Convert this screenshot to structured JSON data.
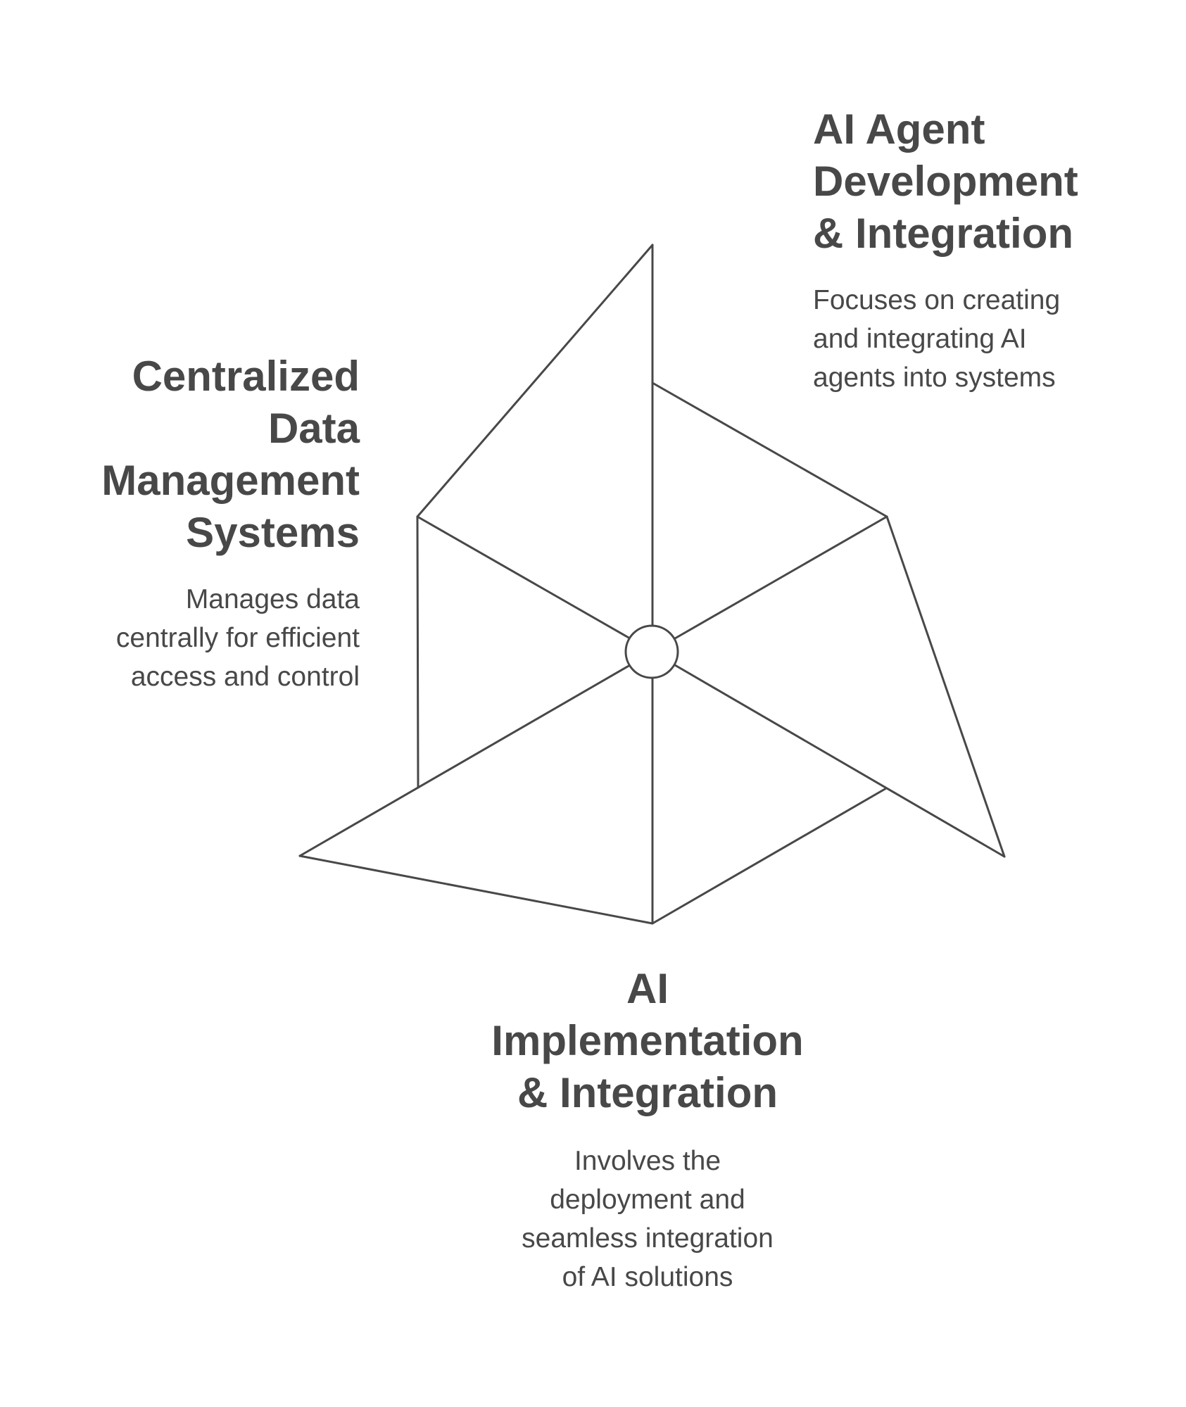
{
  "diagram": {
    "type": "three-segment hexagonal pinwheel",
    "stroke_color": "#484848",
    "text_color": "#484848",
    "background": "#ffffff",
    "segments": [
      {
        "id": "agent",
        "title_lines": [
          "AI Agent",
          "Development",
          "& Integration"
        ],
        "description_lines": [
          "Focuses on creating",
          "and integrating AI",
          "agents into systems"
        ],
        "position": "top-right"
      },
      {
        "id": "data",
        "title_lines": [
          "Centralized",
          "Data",
          "Management",
          "Systems"
        ],
        "description_lines": [
          "Manages data",
          "centrally for efficient",
          "access and control"
        ],
        "position": "left"
      },
      {
        "id": "impl",
        "title_lines": [
          "AI",
          "Implementation",
          "& Integration"
        ],
        "description_lines": [
          "Involves the",
          "deployment and",
          "seamless integration",
          "of AI solutions"
        ],
        "position": "bottom"
      }
    ]
  }
}
